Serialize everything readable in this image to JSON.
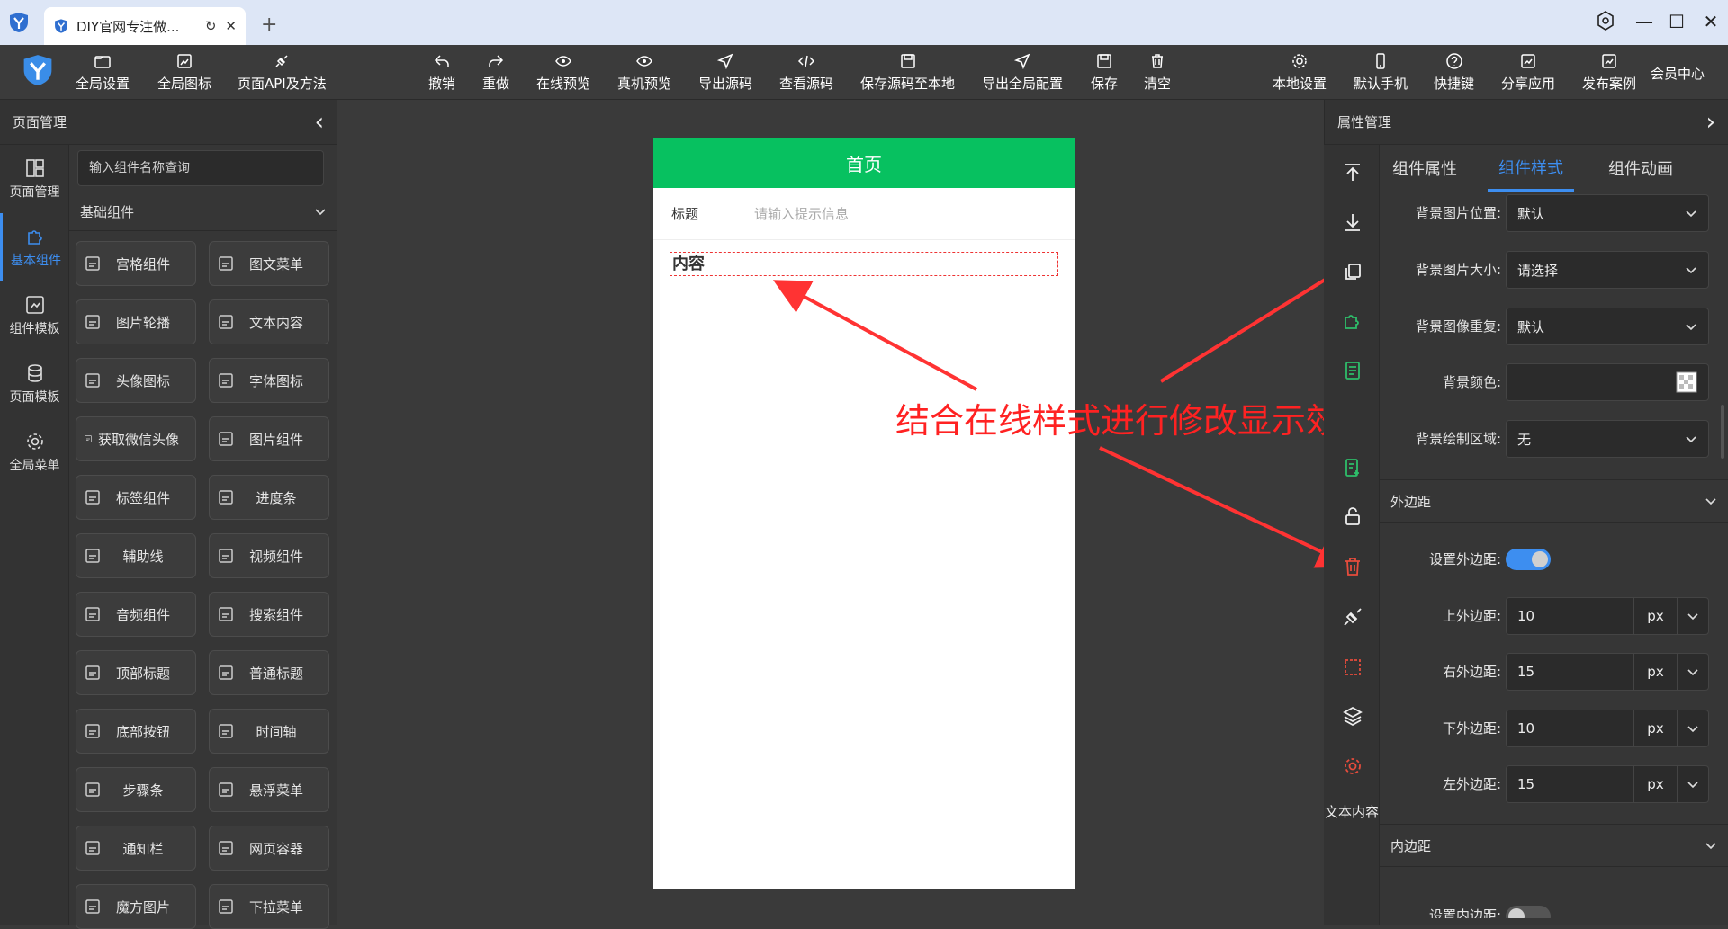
{
  "browser": {
    "tab_title": "DIY官网专注做...",
    "reload_glyph": "↻",
    "close_glyph": "✕",
    "newtab_glyph": "+"
  },
  "window_controls": {
    "minimize": "—",
    "maximize": "☐",
    "close": "✕"
  },
  "toolbar": {
    "global_settings": "全局设置",
    "global_icons": "全局图标",
    "page_api": "页面API及方法",
    "undo": "撤销",
    "redo": "重做",
    "online_preview": "在线预览",
    "device_preview": "真机预览",
    "export_source": "导出源码",
    "view_source": "查看源码",
    "save_source_local": "保存源码至本地",
    "export_global_config": "导出全局配置",
    "save": "保存",
    "clear": "清空",
    "local_settings": "本地设置",
    "default_phone": "默认手机",
    "shortcuts": "快捷键",
    "share_app": "分享应用",
    "publish_case": "发布案例",
    "member_center": "会员中心"
  },
  "left_panel": {
    "title": "页面管理",
    "collapse_glyph": "‹",
    "nav": [
      {
        "label": "页面管理",
        "icon": "layout-icon"
      },
      {
        "label": "基本组件",
        "icon": "puzzle-icon"
      },
      {
        "label": "组件模板",
        "icon": "template-icon"
      },
      {
        "label": "页面模板",
        "icon": "database-icon"
      },
      {
        "label": "全局菜单",
        "icon": "gear-icon"
      }
    ],
    "search_placeholder": "输入组件名称查询",
    "category": "基础组件",
    "components": [
      "宫格组件",
      "图文菜单",
      "图片轮播",
      "文本内容",
      "头像图标",
      "字体图标",
      "获取微信头像",
      "图片组件",
      "标签组件",
      "进度条",
      "辅助线",
      "视频组件",
      "音频组件",
      "搜索组件",
      "顶部标题",
      "普通标题",
      "底部按钮",
      "时间轴",
      "步骤条",
      "悬浮菜单",
      "通知栏",
      "网页容器",
      "魔方图片",
      "下拉菜单"
    ]
  },
  "canvas": {
    "page_title": "首页",
    "field_label": "标题",
    "field_placeholder": "请输入提示信息",
    "content_text": "内容",
    "annotation": "结合在线样式进行修改显示效果",
    "colors": {
      "header": "#07c160",
      "annotation": "#ff2222"
    }
  },
  "right_panel": {
    "title": "属性管理",
    "collapse_glyph": "›",
    "tabs": [
      "组件属性",
      "组件样式",
      "组件动画"
    ],
    "active_tab": 1,
    "bg_props": [
      {
        "label": "背景图片位置:",
        "value": "默认"
      },
      {
        "label": "背景图片大小:",
        "value": "请选择"
      },
      {
        "label": "背景图像重复:",
        "value": "默认"
      },
      {
        "label": "背景颜色:",
        "value": ""
      },
      {
        "label": "背景绘制区域:",
        "value": "无"
      }
    ],
    "margin_section": "外边距",
    "margin_toggle_label": "设置外边距:",
    "margin_enabled": true,
    "margins": [
      {
        "label": "上外边距:",
        "value": "10",
        "unit": "px"
      },
      {
        "label": "右外边距:",
        "value": "15",
        "unit": "px"
      },
      {
        "label": "下外边距:",
        "value": "10",
        "unit": "px"
      },
      {
        "label": "左外边距:",
        "value": "15",
        "unit": "px"
      }
    ],
    "padding_section": "内边距",
    "padding_toggle_label": "设置内边距:",
    "padding_enabled": false,
    "side_text": "文本内容",
    "accent": "#3d8ef0"
  }
}
